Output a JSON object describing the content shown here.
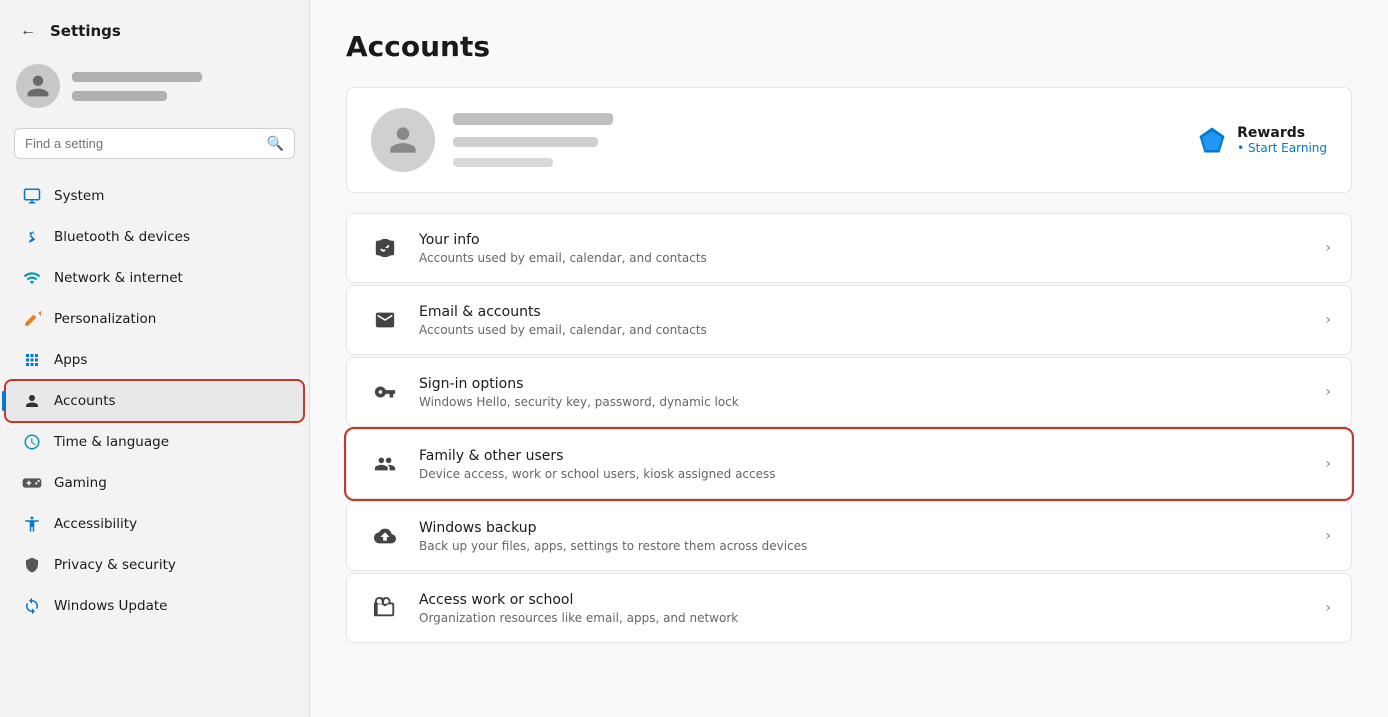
{
  "header": {
    "back_label": "←",
    "title": "Settings"
  },
  "search": {
    "placeholder": "Find a setting",
    "icon": "🔍"
  },
  "user": {
    "avatar_initials": "",
    "name_blur_widths": [
      120,
      90,
      70
    ],
    "profile_blur_widths": [
      140,
      130,
      80
    ]
  },
  "nav": {
    "items": [
      {
        "id": "system",
        "label": "System",
        "icon": "🖥",
        "active": false
      },
      {
        "id": "bluetooth",
        "label": "Bluetooth & devices",
        "icon": "🔵",
        "active": false
      },
      {
        "id": "network",
        "label": "Network & internet",
        "icon": "🔷",
        "active": false
      },
      {
        "id": "personalization",
        "label": "Personalization",
        "icon": "✏️",
        "active": false
      },
      {
        "id": "apps",
        "label": "Apps",
        "icon": "📦",
        "active": false
      },
      {
        "id": "accounts",
        "label": "Accounts",
        "icon": "👤",
        "active": true
      },
      {
        "id": "time",
        "label": "Time & language",
        "icon": "🌐",
        "active": false
      },
      {
        "id": "gaming",
        "label": "Gaming",
        "icon": "🎮",
        "active": false
      },
      {
        "id": "accessibility",
        "label": "Accessibility",
        "icon": "♿",
        "active": false
      },
      {
        "id": "privacy",
        "label": "Privacy & security",
        "icon": "🛡",
        "active": false
      },
      {
        "id": "windows-update",
        "label": "Windows Update",
        "icon": "🔄",
        "active": false
      }
    ]
  },
  "page": {
    "title": "Accounts"
  },
  "rewards": {
    "title": "Rewards",
    "subtitle": "• Start Earning"
  },
  "settings_items": [
    {
      "id": "your-info",
      "title": "Your info",
      "desc": "Accounts used by email, calendar, and contacts",
      "icon": "👤",
      "highlighted": false
    },
    {
      "id": "email-accounts",
      "title": "Email & accounts",
      "desc": "Accounts used by email, calendar, and contacts",
      "icon": "✉️",
      "highlighted": false
    },
    {
      "id": "sign-in",
      "title": "Sign-in options",
      "desc": "Windows Hello, security key, password, dynamic lock",
      "icon": "🔑",
      "highlighted": false
    },
    {
      "id": "family-users",
      "title": "Family & other users",
      "desc": "Device access, work or school users, kiosk assigned access",
      "icon": "👥",
      "highlighted": true
    },
    {
      "id": "windows-backup",
      "title": "Windows backup",
      "desc": "Back up your files, apps, settings to restore them across devices",
      "icon": "☁️",
      "highlighted": false
    },
    {
      "id": "access-work",
      "title": "Access work or school",
      "desc": "Organization resources like email, apps, and network",
      "icon": "💼",
      "highlighted": false
    }
  ]
}
